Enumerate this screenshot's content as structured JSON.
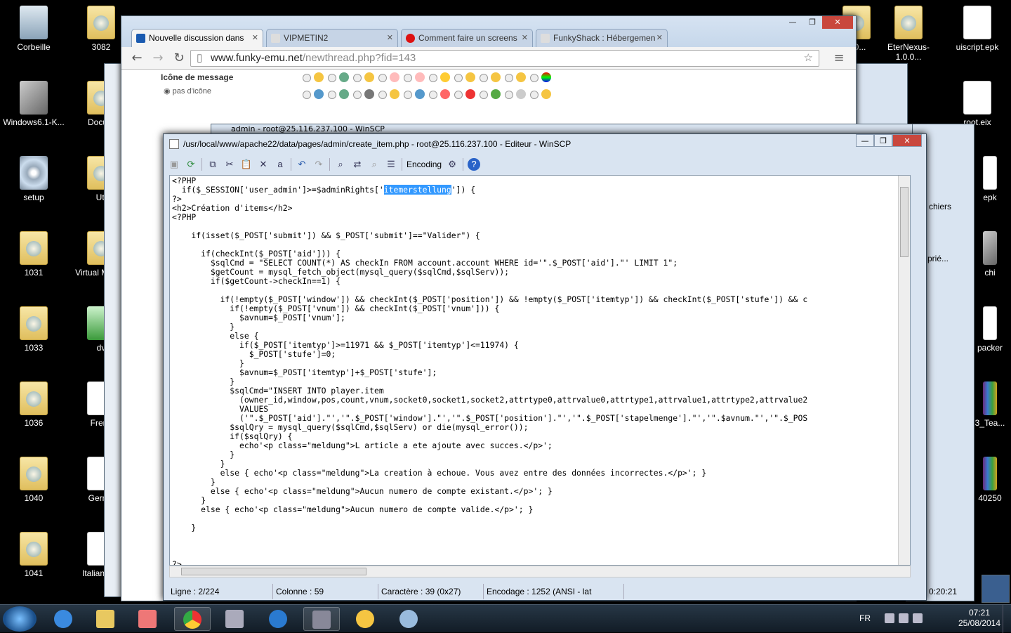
{
  "desktop": {
    "icons": [
      {
        "label": "Corbeille"
      },
      {
        "label": "3082"
      },
      {
        "label": "Windows6.1-K..."
      },
      {
        "label": "Docum"
      },
      {
        "label": "setup"
      },
      {
        "label": "Uti"
      },
      {
        "label": "1031"
      },
      {
        "label": "Virtual M Addi"
      },
      {
        "label": "1033"
      },
      {
        "label": "dv"
      },
      {
        "label": "1036"
      },
      {
        "label": "Frenc"
      },
      {
        "label": "1040"
      },
      {
        "label": "Germa"
      },
      {
        "label": "1041"
      },
      {
        "label": "Italian.dict"
      },
      {
        "label": "0.0..."
      },
      {
        "label": "EterNexus-1.0.0..."
      },
      {
        "label": "uiscript.epk"
      },
      {
        "label": "root.eix"
      },
      {
        "label": "epk"
      },
      {
        "label": "chi"
      },
      {
        "label": "packer"
      },
      {
        "label": "3_Tea..."
      },
      {
        "label": "40250"
      }
    ]
  },
  "chrome": {
    "tabs": [
      {
        "label": "Nouvelle discussion dans",
        "active": true
      },
      {
        "label": "VIPMETIN2",
        "active": false
      },
      {
        "label": "Comment faire un screens",
        "active": false
      },
      {
        "label": "FunkyShack : Hébergemen",
        "active": false
      }
    ],
    "url_host": "www.funky-emu.net",
    "url_path": "/newthread.php?fid=143",
    "page": {
      "message_icon_label": "Icône de message",
      "no_icon_label": "pas d'icône"
    }
  },
  "bg": {
    "winscp_title": "admin - root@25.116.237.100 - WinSCP",
    "fichiers": "chiers",
    "prie": "prié...",
    "time": "0:20:21"
  },
  "editor": {
    "title": "/usr/local/www/apache22/data/pages/admin/create_item.php - root@25.116.237.100 - Editeur - WinSCP",
    "encoding_label": "Encoding",
    "code_lines": [
      "<?PHP",
      "  if($_SESSION['user_admin']>=$adminRights['",
      "?>",
      "<h2>Création d'items</h2>",
      "<?PHP",
      "",
      "    if(isset($_POST['submit']) && $_POST['submit']==\"Valider\") {",
      "",
      "      if(checkInt($_POST['aid'])) {",
      "        $sqlCmd = \"SELECT COUNT(*) AS checkIn FROM account.account WHERE id='\".$_POST['aid'].\"' LIMIT 1\";",
      "        $getCount = mysql_fetch_object(mysql_query($sqlCmd,$sqlServ));",
      "        if($getCount->checkIn==1) {",
      "",
      "          if(!empty($_POST['window']) && checkInt($_POST['position']) && !empty($_POST['itemtyp']) && checkInt($_POST['stufe']) && c",
      "            if(!empty($_POST['vnum']) && checkInt($_POST['vnum'])) {",
      "              $avnum=$_POST['vnum'];",
      "            }",
      "            else {",
      "              if($_POST['itemtyp']>=11971 && $_POST['itemtyp']<=11974) {",
      "                $_POST['stufe']=0;",
      "              }",
      "              $avnum=$_POST['itemtyp']+$_POST['stufe'];",
      "            }",
      "            $sqlCmd=\"INSERT INTO player.item",
      "              (owner_id,window,pos,count,vnum,socket0,socket1,socket2,attrtype0,attrvalue0,attrtype1,attrvalue1,attrtype2,attrvalue2",
      "              VALUES",
      "              ('\".$_POST['aid'].\"','\".$_POST['window'].\"','\".$_POST['position'].\"','\".$_POST['stapelmenge'].\"','\".$avnum.\"','\".$_POS",
      "            $sqlQry = mysql_query($sqlCmd,$sqlServ) or die(mysql_error());",
      "            if($sqlQry) {",
      "              echo'<p class=\"meldung\">L article a ete ajoute avec succes.</p>';",
      "            }",
      "          }",
      "          else { echo'<p class=\"meldung\">La creation à echoue. Vous avez entre des données incorrectes.</p>'; }",
      "        }",
      "        else { echo'<p class=\"meldung\">Aucun numero de compte existant.</p>'; }",
      "      }",
      "      else { echo'<p class=\"meldung\">Aucun numero de compte valide.</p>'; }",
      "",
      "    }",
      "",
      "",
      "",
      "?>"
    ],
    "highlight_word": "itemerstellung",
    "line1_tail": "']) {",
    "status": {
      "ligne": "Ligne : 2/224",
      "colonne": "Colonne : 59",
      "caractere": "Caractère : 39 (0x27)",
      "encodage": "Encodage : 1252  (ANSI - lat"
    }
  },
  "taskbar": {
    "lang": "FR",
    "time": "07:21",
    "date": "25/08/2014"
  }
}
